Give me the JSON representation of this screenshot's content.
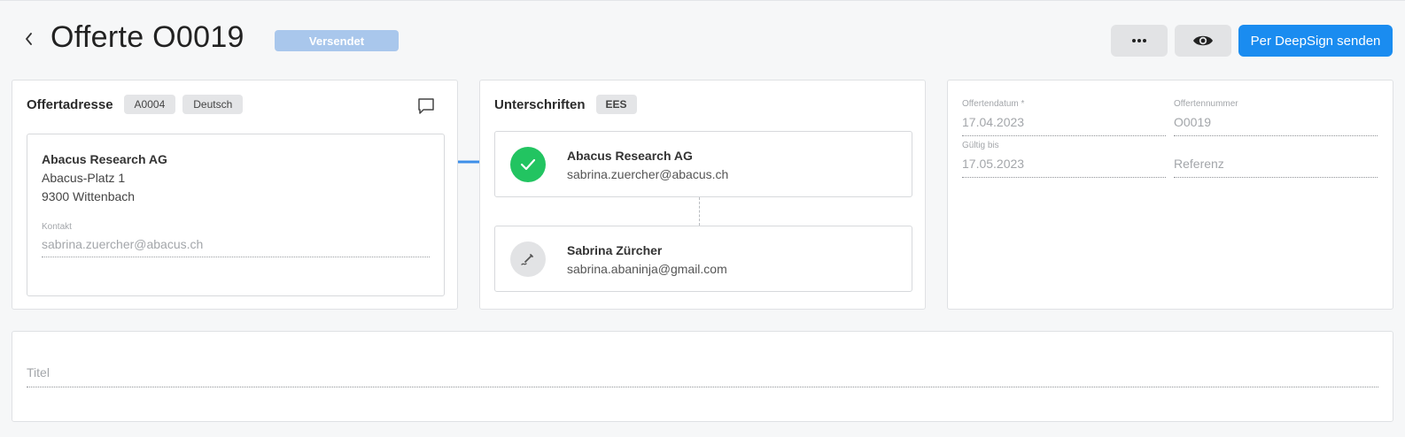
{
  "header": {
    "title": "Offerte O0019",
    "status": "Versendet",
    "primary_action": "Per DeepSign senden"
  },
  "colors": {
    "primary": "#1a8cf0",
    "status_badge": "#a9c7ec",
    "success": "#22c461",
    "arrow": "#3d8fe8"
  },
  "icons": {
    "back": "chevron-left-icon",
    "more": "more-dots-icon",
    "preview": "eye-icon",
    "comment": "comment-icon",
    "signed": "check-icon",
    "pending": "pen-icon"
  },
  "address_card": {
    "heading": "Offertadresse",
    "chips": [
      "A0004",
      "Deutsch"
    ],
    "name": "Abacus Research AG",
    "street": "Abacus-Platz 1",
    "city": "9300 Wittenbach",
    "contact_label": "Kontakt",
    "contact_value": "sabrina.zuercher@abacus.ch"
  },
  "signatures_card": {
    "heading": "Unterschriften",
    "chip": "EES",
    "signers": [
      {
        "name": "Abacus Research AG",
        "email": "sabrina.zuercher@abacus.ch",
        "status": "signed"
      },
      {
        "name": "Sabrina Zürcher",
        "email": "sabrina.abaninja@gmail.com",
        "status": "pending"
      }
    ]
  },
  "details_card": {
    "fields": [
      {
        "label": "Offertendatum *",
        "value": "17.04.2023"
      },
      {
        "label": "Offertennummer",
        "value": "O0019"
      },
      {
        "label": "Gültig bis",
        "value": "17.05.2023"
      },
      {
        "label": "",
        "value": "Referenz"
      }
    ]
  },
  "title_card": {
    "placeholder": "Titel"
  }
}
